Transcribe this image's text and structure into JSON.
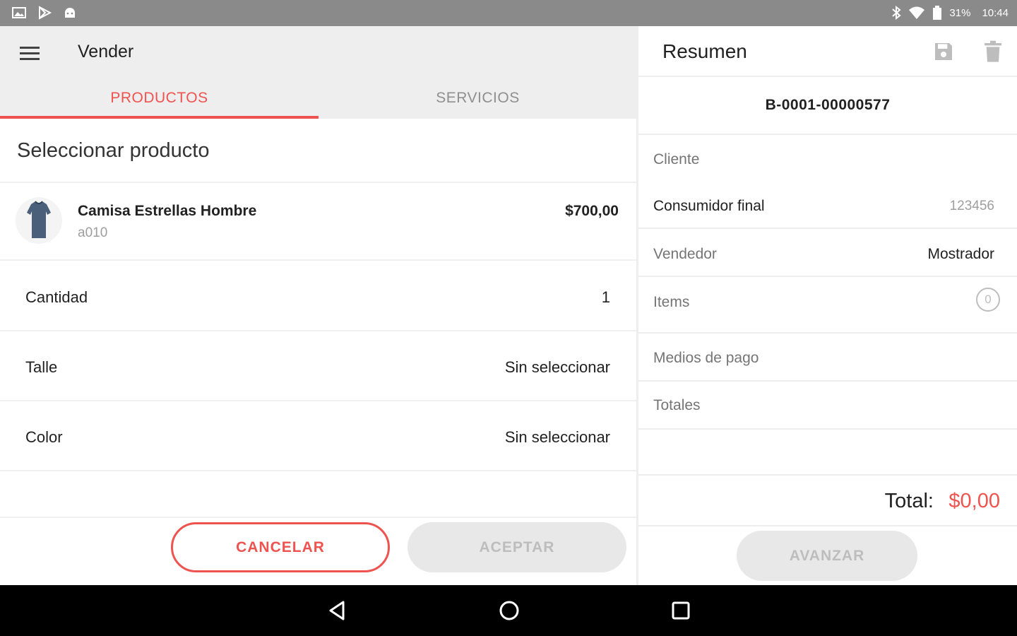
{
  "status_bar": {
    "battery": "31%",
    "time": "10:44"
  },
  "left_pane": {
    "title": "Vender",
    "tabs": [
      {
        "label": "PRODUCTOS",
        "active": true
      },
      {
        "label": "SERVICIOS",
        "active": false
      }
    ],
    "section_title": "Seleccionar producto",
    "product": {
      "name": "Camisa Estrellas Hombre",
      "code": "a010",
      "price": "$700,00"
    },
    "fields": [
      {
        "label": "Cantidad",
        "value": "1"
      },
      {
        "label": "Talle",
        "value": "Sin seleccionar"
      },
      {
        "label": "Color",
        "value": "Sin seleccionar"
      }
    ],
    "cancel_label": "CANCELAR",
    "accept_label": "ACEPTAR"
  },
  "right_pane": {
    "title": "Resumen",
    "invoice_number": "B-0001-00000577",
    "client_label": "Cliente",
    "client_name": "Consumidor final",
    "client_code": "123456",
    "seller_label": "Vendedor",
    "seller_value": "Mostrador",
    "items_label": "Items",
    "items_count": "0",
    "payment_label": "Medios de pago",
    "totals_label": "Totales",
    "total_label": "Total:",
    "total_value": "$0,00",
    "advance_label": "AVANZAR"
  },
  "colors": {
    "accent": "#ef5350",
    "appbar_bg": "#eeeeee",
    "status_bar_bg": "#8a8a8a",
    "disabled_bg": "#e8e8e8",
    "disabled_text": "#bdbdbd"
  },
  "icons": [
    "image-icon",
    "play-store-icon",
    "android-icon",
    "bluetooth-icon",
    "wifi-icon",
    "battery-icon",
    "menu-icon",
    "shirt-icon",
    "save-icon",
    "trash-icon",
    "back-icon",
    "home-icon",
    "recents-icon"
  ]
}
